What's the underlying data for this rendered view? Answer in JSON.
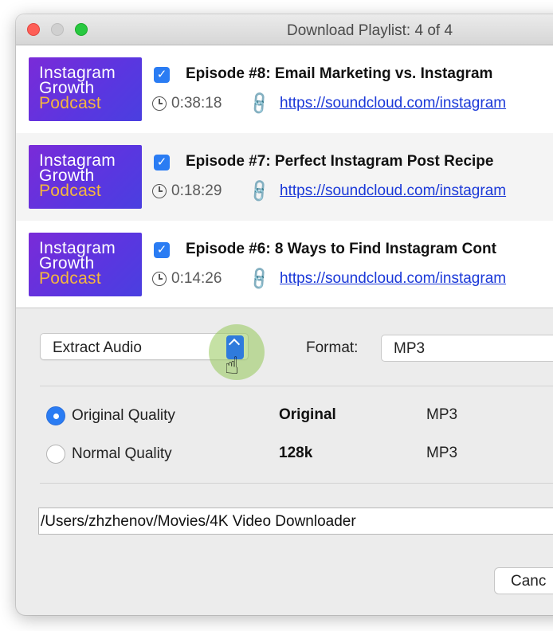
{
  "window": {
    "title": "Download Playlist: 4 of 4"
  },
  "episodes": [
    {
      "thumb": {
        "line1": "Instagram",
        "line2": "Growth",
        "line3": "Podcast"
      },
      "checked": true,
      "title": "Episode #8: Email Marketing vs. Instagram",
      "duration": "0:38:18",
      "url": "https://soundcloud.com/instagram"
    },
    {
      "thumb": {
        "line1": "Instagram",
        "line2": "Growth",
        "line3": "Podcast"
      },
      "checked": true,
      "title": "Episode #7: Perfect Instagram Post Recipe",
      "duration": "0:18:29",
      "url": "https://soundcloud.com/instagram"
    },
    {
      "thumb": {
        "line1": "Instagram",
        "line2": "Growth",
        "line3": "Podcast"
      },
      "checked": true,
      "title": "Episode #6: 8 Ways to Find Instagram Cont",
      "duration": "0:14:26",
      "url": "https://soundcloud.com/instagram"
    }
  ],
  "options": {
    "mode": "Extract Audio",
    "format_label": "Format:",
    "format_value": "MP3"
  },
  "quality": [
    {
      "label": "Original Quality",
      "value": "Original",
      "format": "MP3",
      "selected": true
    },
    {
      "label": "Normal Quality",
      "value": "128k",
      "format": "MP3",
      "selected": false
    }
  ],
  "save_path": "/Users/zhzhenov/Movies/4K Video Downloader",
  "buttons": {
    "cancel": "Canc"
  },
  "colors": {
    "accent": "#2a7cf3",
    "link": "#1a38d8",
    "thumb_bg": "#6a32dc",
    "thumb_accent": "#f5b73d",
    "highlight": "#96c85a"
  }
}
